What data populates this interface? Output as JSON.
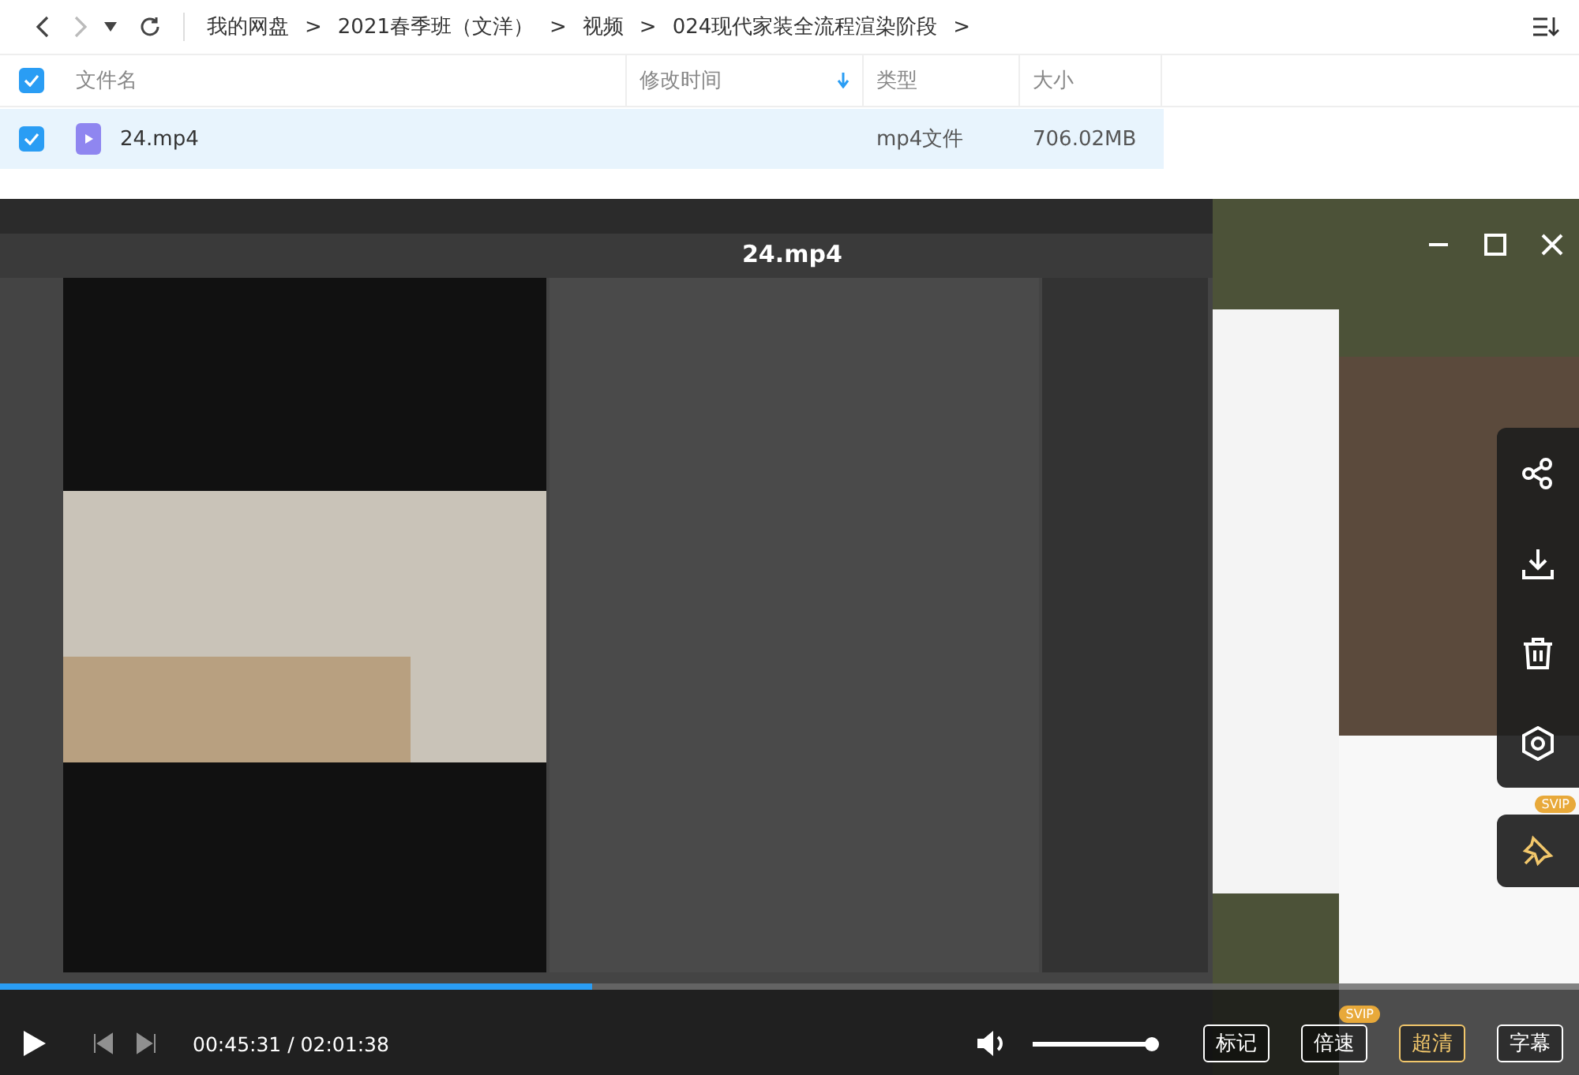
{
  "breadcrumb": [
    "我的网盘",
    "2021春季班（文洋）",
    "视频",
    "024现代家装全流程渲染阶段"
  ],
  "separator": ">",
  "columns": [
    {
      "label": "文件名",
      "sorted": false
    },
    {
      "label": "修改时间",
      "sorted": true
    },
    {
      "label": "类型",
      "sorted": false
    },
    {
      "label": "大小",
      "sorted": false
    }
  ],
  "header_checked": true,
  "files": [
    {
      "name": "24.mp4",
      "type": "mp4文件",
      "size": "706.02MB",
      "checked": true,
      "selected": true
    }
  ],
  "player": {
    "title": "24.mp4",
    "progress": {
      "level": 0.375
    },
    "time": "00:45:31 / 02:01:38",
    "volume": {
      "level": 1
    },
    "buttons": [
      {
        "label": "标记",
        "selected": false
      },
      {
        "label": "倍速",
        "selected": false,
        "badge": "SVIP"
      },
      {
        "label": "超清",
        "selected": true
      },
      {
        "label": "字幕",
        "selected": false
      }
    ],
    "pin_badge": "SVIP"
  }
}
